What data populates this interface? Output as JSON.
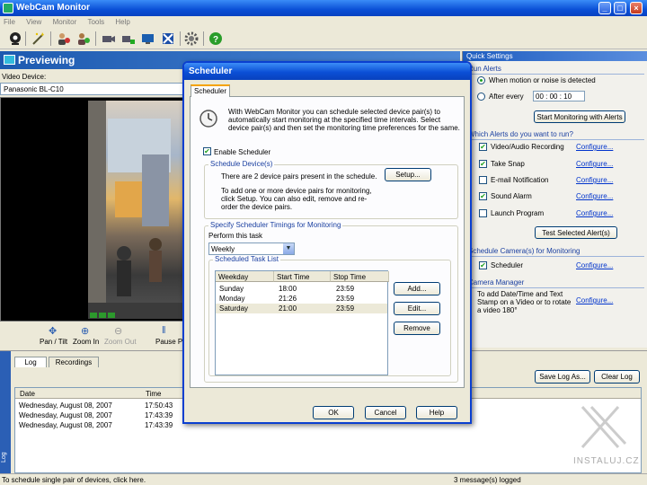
{
  "app": {
    "title": "WebCam Monitor"
  },
  "window_controls": {
    "minimize": "_",
    "maximize": "□",
    "close": "×"
  },
  "menu": [
    "File",
    "View",
    "Monitor",
    "Tools",
    "Help"
  ],
  "toolbar_icons": [
    "camera-icon",
    "wizard-icon",
    "people-icon",
    "settings-people-icon",
    "camcorder-icon",
    "add-camera-icon",
    "monitor-icon",
    "network-icon",
    "gear-icon",
    "help-icon"
  ],
  "preview": {
    "header": "Previewing",
    "video_device_label": "Video Device:",
    "video_device_value": "Panasonic BL-C10",
    "controls": [
      "Pan / Tilt",
      "Zoom In",
      "Zoom Out",
      "Pause Pr"
    ]
  },
  "quick_settings": {
    "header": "Quick Settings",
    "run_alerts": "Run Alerts",
    "when_motion": "When motion or noise is detected",
    "after_every": "After every",
    "after_every_value": "00 : 00 : 10",
    "start_button": "Start Monitoring with Alerts",
    "which_alerts": "Which Alerts do you want to run?",
    "alerts": [
      {
        "label": "Video/Audio Recording",
        "checked": true,
        "link": "Configure..."
      },
      {
        "label": "Take Snap",
        "checked": true,
        "link": "Configure..."
      },
      {
        "label": "E-mail Notification",
        "checked": false,
        "link": "Configure..."
      },
      {
        "label": "Sound Alarm",
        "checked": true,
        "link": "Configure..."
      },
      {
        "label": "Launch Program",
        "checked": false,
        "link": "Configure..."
      }
    ],
    "test_button": "Test Selected Alert(s)",
    "schedule_cameras": "Schedule Camera(s) for Monitoring",
    "scheduler_label": "Scheduler",
    "scheduler_link": "Configure...",
    "camera_manager": "Camera Manager",
    "camera_manager_text": "To add Date/Time and Text Stamp on a Video or to rotate a video 180°",
    "camera_manager_link": "Configure..."
  },
  "log": {
    "tabs": [
      "Log",
      "Recordings"
    ],
    "save_button": "Save Log As...",
    "clear_button": "Clear Log",
    "columns": [
      "Date",
      "Time"
    ],
    "rows": [
      [
        "Wednesday, August 08, 2007",
        "17:50:43"
      ],
      [
        "Wednesday, August 08, 2007",
        "17:43:39"
      ],
      [
        "Wednesday, August 08, 2007",
        "17:43:39"
      ]
    ],
    "sidebar_label": "Log"
  },
  "status": {
    "left": "To schedule single pair of devices, click here.",
    "right": "3 message(s) logged"
  },
  "watermark": "INSTALUJ.CZ",
  "dialog": {
    "title": "Scheduler",
    "tab": "Scheduler",
    "intro": "With WebCam Monitor you can schedule selected device pair(s) to automatically start monitoring at the specified time intervals. Select device pair(s) and then set the monitoring time preferences for the same.",
    "enable_label": "Enable Scheduler",
    "schedule_devices_title": "Schedule Device(s)",
    "device_pairs_text": "There are 2 device pairs present in the schedule.",
    "setup_button": "Setup...",
    "add_devices_text": "To add one or more device pairs for monitoring, click Setup. You can also edit, remove and re-order the device pairs.",
    "timings_title": "Specify Scheduler Timings for Monitoring",
    "perform_label": "Perform this task",
    "frequency": "Weekly",
    "task_list_title": "Scheduled Task List",
    "task_columns": [
      "Weekday",
      "Start Time",
      "Stop Time"
    ],
    "tasks": [
      [
        "Sunday",
        "18:00",
        "23:59"
      ],
      [
        "Monday",
        "21:26",
        "23:59"
      ],
      [
        "Saturday",
        "21:00",
        "23:59"
      ]
    ],
    "add_button": "Add...",
    "edit_button": "Edit...",
    "remove_button": "Remove",
    "ok_button": "OK",
    "cancel_button": "Cancel",
    "help_button": "Help"
  }
}
